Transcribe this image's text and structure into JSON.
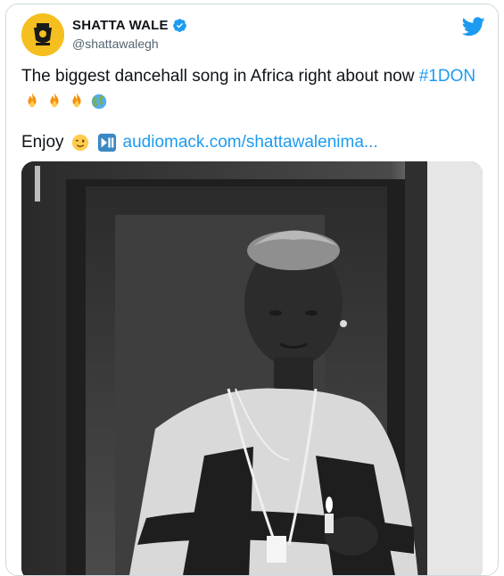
{
  "tweet": {
    "author_name": "SHATTA WALE",
    "author_handle": "@shattawalegh",
    "text_main": "The biggest dancehall song in Africa right about now ",
    "hashtag": "#1DON",
    "emojis": [
      "fire-emoji",
      "fire-emoji",
      "fire-emoji",
      "globe-emoji"
    ],
    "enjoy_text": "Enjoy",
    "link_text": "audiomack.com/shattawalenima..."
  },
  "icons": {
    "verified": "verified-badge-icon",
    "twitter": "twitter-bird-icon",
    "wink": "winking-face-emoji",
    "play_pause": "play-pause-button-emoji"
  },
  "colors": {
    "accent": "#1d9bf0",
    "avatar_bg": "#f5bf1f",
    "text": "#0f1419",
    "muted": "#536471"
  }
}
